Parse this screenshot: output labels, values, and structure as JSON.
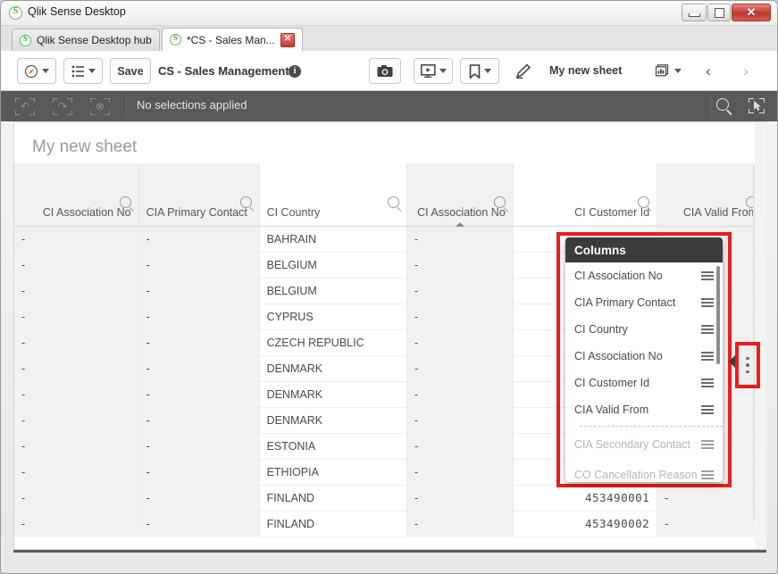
{
  "window": {
    "title": "Qlik Sense Desktop",
    "app_icon": "qlik-logo-icon",
    "controls": {
      "minimize": "minimize-icon",
      "restore": "restore-icon",
      "close": "✕"
    }
  },
  "tabs": [
    {
      "label": "Qlik Sense Desktop hub",
      "active": false,
      "closable": false
    },
    {
      "label": "*CS - Sales Man...",
      "active": true,
      "closable": true,
      "close_glyph": "✕"
    }
  ],
  "toolbar": {
    "nav_icon": "compass-icon",
    "sheetlist_icon": "list-icon",
    "save_label": "Save",
    "app_title": "CS - Sales Management",
    "info_glyph": "i",
    "snapshot_icon": "camera-icon",
    "story_icon": "storytelling-icon",
    "bookmark_icon": "bookmark-icon",
    "edit_icon": "pencil-icon",
    "sheet_name": "My new sheet",
    "sheet_selector_icon": "sheet-grid-icon",
    "prev_glyph": "‹",
    "next_glyph": "›"
  },
  "selections_bar": {
    "undo_icon": "undo-icon",
    "redo_icon": "redo-icon",
    "clear_icon": "clear-selections-icon",
    "status_text": "No selections applied",
    "search_icon": "search-icon",
    "selection_tool_icon": "selection-tool-icon",
    "undo_glyph": "↶",
    "redo_glyph": "↷",
    "clear_glyph": "⊗"
  },
  "sheet": {
    "heading": "My new sheet"
  },
  "table": {
    "columns": [
      {
        "label": "CI Association No",
        "align": "right",
        "shaded": true,
        "sorted": false
      },
      {
        "label": "CIA Primary Contact",
        "align": "left",
        "shaded": true,
        "sorted": false
      },
      {
        "label": "CI Country",
        "align": "left",
        "shaded": false,
        "sorted": false
      },
      {
        "label": "CI Association No",
        "align": "right",
        "shaded": true,
        "sorted": true
      },
      {
        "label": "CI Customer Id",
        "align": "right",
        "shaded": false,
        "sorted": false
      },
      {
        "label": "CIA Valid From",
        "align": "right",
        "shaded": true,
        "sorted": false
      }
    ],
    "search_icon": "search-icon",
    "sort_indicator": "sort-ascending-icon",
    "rows": [
      [
        "-",
        "-",
        "BAHRAIN",
        "-",
        "",
        "-"
      ],
      [
        "-",
        "-",
        "BELGIUM",
        "-",
        "",
        "-"
      ],
      [
        "-",
        "-",
        "BELGIUM",
        "-",
        "",
        "-"
      ],
      [
        "-",
        "-",
        "CYPRUS",
        "-",
        "",
        "-"
      ],
      [
        "-",
        "-",
        "CZECH REPUBLIC",
        "-",
        "",
        "-"
      ],
      [
        "-",
        "-",
        "DENMARK",
        "-",
        "",
        "-"
      ],
      [
        "-",
        "-",
        "DENMARK",
        "-",
        "",
        "-"
      ],
      [
        "-",
        "-",
        "DENMARK",
        "-",
        "",
        "-"
      ],
      [
        "-",
        "-",
        "ESTONIA",
        "-",
        "",
        "-"
      ],
      [
        "-",
        "-",
        "ETHIOPIA",
        "-",
        "",
        "-"
      ],
      [
        "-",
        "-",
        "FINLAND",
        "-",
        "453490001",
        "-"
      ],
      [
        "-",
        "-",
        "FINLAND",
        "-",
        "453490002",
        "-"
      ]
    ]
  },
  "columns_popup": {
    "title": "Columns",
    "drag_handle_icon": "drag-handle-icon",
    "active_items": [
      "CI Association No",
      "CIA Primary Contact",
      "CI Country",
      "CI Association No",
      "CI Customer Id",
      "CIA Valid From"
    ],
    "inactive_items": [
      "CIA Secondary Contact",
      "CO Cancellation Reason"
    ]
  },
  "side_menu": {
    "more_icon": "more-vertical-icon",
    "collapse_arrow_icon": "caret-left-icon"
  },
  "colors": {
    "highlight": "#ee1c1c",
    "selbar": "#595959",
    "popup_header": "#3b3b3b",
    "shaded_cell": "#f1f1f1",
    "accent_green": "#5bbf5b"
  }
}
